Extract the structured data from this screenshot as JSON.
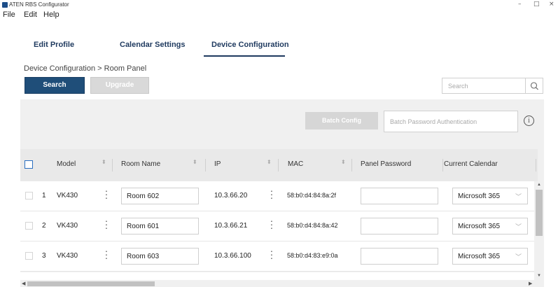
{
  "window": {
    "title": "ATEN RBS Configurator",
    "controls": {
      "minimize": "–",
      "maximize": "□",
      "close": "×"
    }
  },
  "menu": [
    "File",
    "Edit",
    "Help"
  ],
  "tabs": [
    {
      "label": "Edit Profile",
      "active": false
    },
    {
      "label": "Calendar Settings",
      "active": false
    },
    {
      "label": "Device Configuration",
      "active": true
    }
  ],
  "breadcrumb": "Device Configuration > Room Panel",
  "toolbar": {
    "search_label": "Search",
    "upgrade_label": "Upgrade",
    "search_placeholder": "Search"
  },
  "batch": {
    "config_label": "Batch Config",
    "password_placeholder": "Batch Password Authentication",
    "info_glyph": "i"
  },
  "table": {
    "headers": [
      "Model",
      "Room Name",
      "IP",
      "MAC",
      "Panel Password",
      "Current Calendar"
    ],
    "rows": [
      {
        "index": "1",
        "model": "VK430",
        "room": "Room 602",
        "ip": "10.3.66.20",
        "mac": "58:b0:d4:84:8a:2f",
        "calendar": "Microsoft 365"
      },
      {
        "index": "2",
        "model": "VK430",
        "room": "Room 601",
        "ip": "10.3.66.21",
        "mac": "58:b0:d4:84:8a:42",
        "calendar": "Microsoft 365"
      },
      {
        "index": "3",
        "model": "VK430",
        "room": "Room 603",
        "ip": "10.3.66.100",
        "mac": "58:b0:d4:83:e9:0a",
        "calendar": "Microsoft 365"
      }
    ]
  },
  "colors": {
    "primary": "#1f4e79",
    "tab_text": "#1f3a5f",
    "disabled": "#d9d9d9",
    "panel_bg": "#f0f0f0"
  }
}
